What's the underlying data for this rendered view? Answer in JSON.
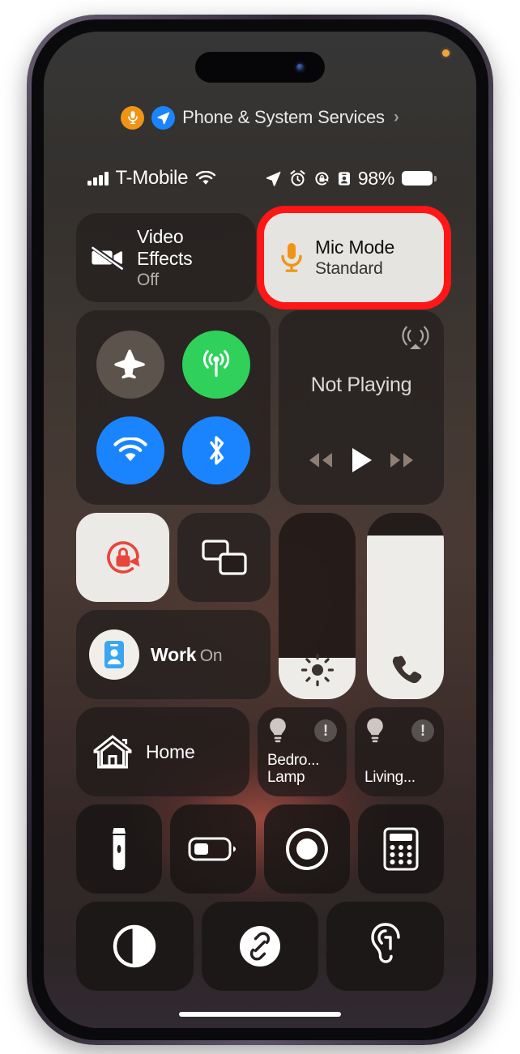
{
  "device": {
    "frame": "iphone-14-pro-deep-purple",
    "privacy_indicator": "orange-mic-dot"
  },
  "services_banner": {
    "label": "Phone & System Services",
    "chevron": "›",
    "icons": [
      "mic-icon",
      "location-arrow-icon"
    ],
    "mic_color": "#f09417",
    "location_color": "#1a84ff"
  },
  "status_bar": {
    "carrier": "T-Mobile",
    "signal_bars": 4,
    "wifi": "wifi-icon",
    "battery_percent": "98%",
    "icons": [
      "location-arrow-icon",
      "alarm-clock-icon",
      "rotation-lock-icon",
      "focus-badge-icon"
    ]
  },
  "control_center": {
    "video_effects": {
      "title": "Video Effects",
      "status": "Off",
      "icon": "video-slash-icon",
      "active": false
    },
    "mic_mode": {
      "title": "Mic Mode",
      "status": "Standard",
      "icon": "mic-icon",
      "active": true,
      "highlighted": true,
      "highlight_color": "#ff1616",
      "icon_color": "#f09417"
    },
    "connectivity": {
      "airplane_mode": {
        "name": "Airplane Mode",
        "state": "off",
        "color": "#5d534d"
      },
      "cellular_data": {
        "name": "Cellular Data",
        "state": "on",
        "color": "#2fd15a"
      },
      "wifi": {
        "name": "Wi-Fi",
        "state": "on",
        "color": "#1a84ff"
      },
      "bluetooth": {
        "name": "Bluetooth",
        "state": "on",
        "color": "#1a84ff"
      }
    },
    "media": {
      "title": "Not Playing",
      "airplay_icon": "airplay-audio-icon",
      "controls": [
        "rewind-icon",
        "play-icon",
        "fast-forward-icon"
      ]
    },
    "rotation_lock": {
      "name": "Portrait Orientation Lock",
      "state": "on",
      "icon": "rotation-lock-icon",
      "color": "#e8453c"
    },
    "screen_mirroring": {
      "name": "Screen Mirroring",
      "state": "off",
      "icon": "screen-mirroring-icon"
    },
    "focus": {
      "title": "Work",
      "status": "On",
      "icon": "work-focus-icon",
      "icon_color": "#38a6f0"
    },
    "brightness": {
      "name": "Display Brightness",
      "level_percent": 22,
      "icon": "brightness-icon"
    },
    "volume": {
      "name": "Volume",
      "level_percent": 88,
      "icon": "phone-handset-icon"
    },
    "home": {
      "title": "Home",
      "icon": "house-icon"
    },
    "accessories": [
      {
        "name": "Bedro...\nLamp",
        "line1": "Bedro...",
        "line2": "Lamp",
        "icon": "lightbulb-icon",
        "badge": "!"
      },
      {
        "name": "Living...",
        "line1": "Living...",
        "line2": "",
        "icon": "lightbulb-icon",
        "badge": "!"
      }
    ],
    "utilities_row1": [
      {
        "name": "Flashlight",
        "icon": "flashlight-icon"
      },
      {
        "name": "Low Power Mode",
        "icon": "battery-icon"
      },
      {
        "name": "Screen Recording",
        "icon": "screen-record-icon"
      },
      {
        "name": "Calculator",
        "icon": "calculator-icon"
      }
    ],
    "utilities_row2": [
      {
        "name": "Dark Mode",
        "icon": "dark-mode-icon"
      },
      {
        "name": "Music Recognition",
        "icon": "shazam-icon"
      },
      {
        "name": "Hearing",
        "icon": "ear-icon"
      }
    ]
  }
}
